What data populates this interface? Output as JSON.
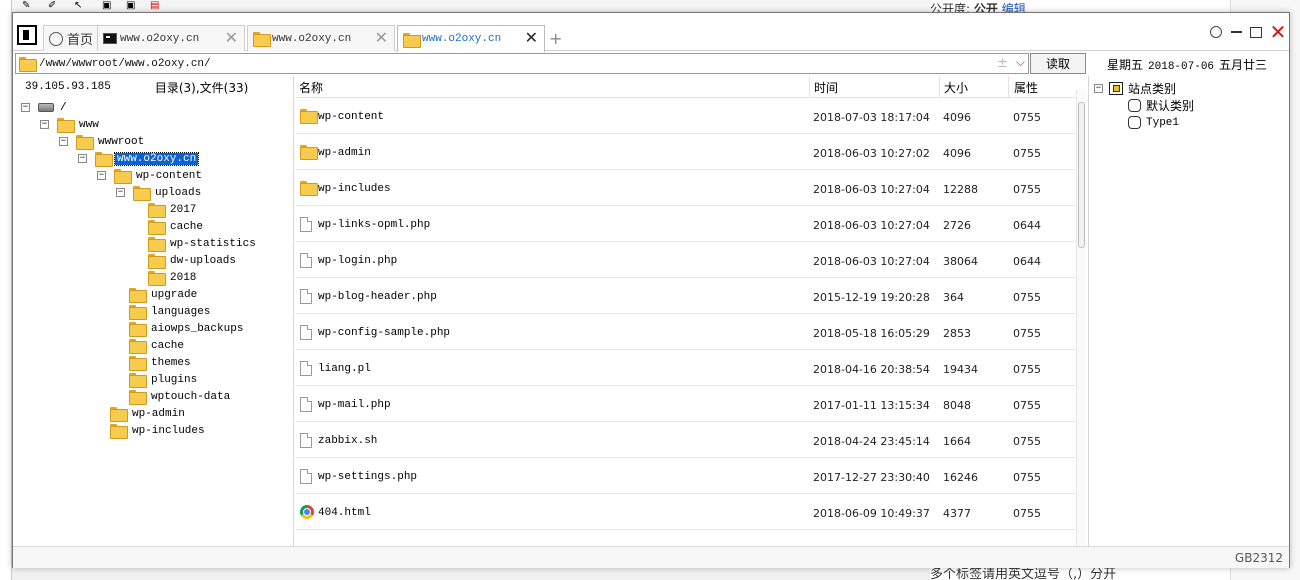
{
  "window": {
    "tabs": [
      {
        "label": "首页",
        "icon": "home-icon"
      },
      {
        "label": "www.o2oxy.cn",
        "icon": "terminal-icon"
      },
      {
        "label": "www.o2oxy.cn",
        "icon": "folder-icon"
      },
      {
        "label": "www.o2oxy.cn",
        "icon": "folder-icon"
      }
    ],
    "add_tab": "+",
    "close_glyph": "✕",
    "controls": {
      "minimize": "—",
      "close": "✕"
    }
  },
  "address": {
    "path": "/www/wwwroot/www.o2oxy.cn/",
    "plusminus": "±",
    "dropdown": "⌵",
    "read_button": "读取"
  },
  "datetime": {
    "weekday": "星期五",
    "date": "2018-07-06",
    "lunar": "五月廿三"
  },
  "left_panel": {
    "ip": "39.105.93.185",
    "summary": "目录(3),文件(33)",
    "tree": [
      {
        "label": "/",
        "icon": "disk-icon",
        "expander": "−"
      },
      {
        "label": "www",
        "icon": "folder-icon",
        "expander": "−"
      },
      {
        "label": "wwwroot",
        "icon": "folder-icon",
        "expander": "−"
      },
      {
        "label": "www.o2oxy.cn",
        "icon": "folder-icon",
        "expander": "−",
        "selected": true
      },
      {
        "label": "wp-content",
        "icon": "folder-icon",
        "expander": "−"
      },
      {
        "label": "uploads",
        "icon": "folder-icon",
        "expander": "−"
      },
      {
        "label": "2017",
        "icon": "folder-icon"
      },
      {
        "label": "cache",
        "icon": "folder-icon"
      },
      {
        "label": "wp-statistics",
        "icon": "folder-icon"
      },
      {
        "label": "dw-uploads",
        "icon": "folder-icon"
      },
      {
        "label": "2018",
        "icon": "folder-icon"
      },
      {
        "label": "upgrade",
        "icon": "folder-icon"
      },
      {
        "label": "languages",
        "icon": "folder-icon"
      },
      {
        "label": "aiowps_backups",
        "icon": "folder-icon"
      },
      {
        "label": "cache",
        "icon": "folder-icon"
      },
      {
        "label": "themes",
        "icon": "folder-icon"
      },
      {
        "label": "plugins",
        "icon": "folder-icon"
      },
      {
        "label": "wptouch-data",
        "icon": "folder-icon"
      },
      {
        "label": "wp-admin",
        "icon": "folder-icon"
      },
      {
        "label": "wp-includes",
        "icon": "folder-icon"
      }
    ]
  },
  "file_list": {
    "columns": {
      "name": "名称",
      "time": "时间",
      "size": "大小",
      "perm": "属性"
    },
    "rows": [
      {
        "icon": "folder-icon",
        "name": "wp-content",
        "time": "2018-07-03 18:17:04",
        "size": "4096",
        "perm": "0755"
      },
      {
        "icon": "folder-icon",
        "name": "wp-admin",
        "time": "2018-06-03 10:27:02",
        "size": "4096",
        "perm": "0755"
      },
      {
        "icon": "folder-icon",
        "name": "wp-includes",
        "time": "2018-06-03 10:27:04",
        "size": "12288",
        "perm": "0755"
      },
      {
        "icon": "file-icon",
        "name": "wp-links-opml.php",
        "time": "2018-06-03 10:27:04",
        "size": "2726",
        "perm": "0644"
      },
      {
        "icon": "file-icon",
        "name": "wp-login.php",
        "time": "2018-06-03 10:27:04",
        "size": "38064",
        "perm": "0644"
      },
      {
        "icon": "file-icon",
        "name": "wp-blog-header.php",
        "time": "2015-12-19 19:20:28",
        "size": "364",
        "perm": "0755"
      },
      {
        "icon": "file-icon",
        "name": "wp-config-sample.php",
        "time": "2018-05-18 16:05:29",
        "size": "2853",
        "perm": "0755"
      },
      {
        "icon": "file-icon",
        "name": "liang.pl",
        "time": "2018-04-16 20:38:54",
        "size": "19434",
        "perm": "0755"
      },
      {
        "icon": "file-icon",
        "name": "wp-mail.php",
        "time": "2017-01-11 13:15:34",
        "size": "8048",
        "perm": "0755"
      },
      {
        "icon": "file-icon",
        "name": "zabbix.sh",
        "time": "2018-04-24 23:45:14",
        "size": "1664",
        "perm": "0755"
      },
      {
        "icon": "file-icon",
        "name": "wp-settings.php",
        "time": "2017-12-27 23:30:40",
        "size": "16246",
        "perm": "0755"
      },
      {
        "icon": "chrome-icon",
        "name": "404.html",
        "time": "2018-06-09 10:49:37",
        "size": "4377",
        "perm": "0755"
      }
    ]
  },
  "right_panel": {
    "root": "站点类别",
    "root_expander": "−",
    "children": [
      "默认类别",
      "Type1"
    ]
  },
  "status": {
    "encoding": "GB2312"
  },
  "background": {
    "top_right_label": "公开度:",
    "top_right_value": "公开",
    "top_right_link": "编辑",
    "bottom_text": "多个标签请用英文逗号（,）分开"
  }
}
